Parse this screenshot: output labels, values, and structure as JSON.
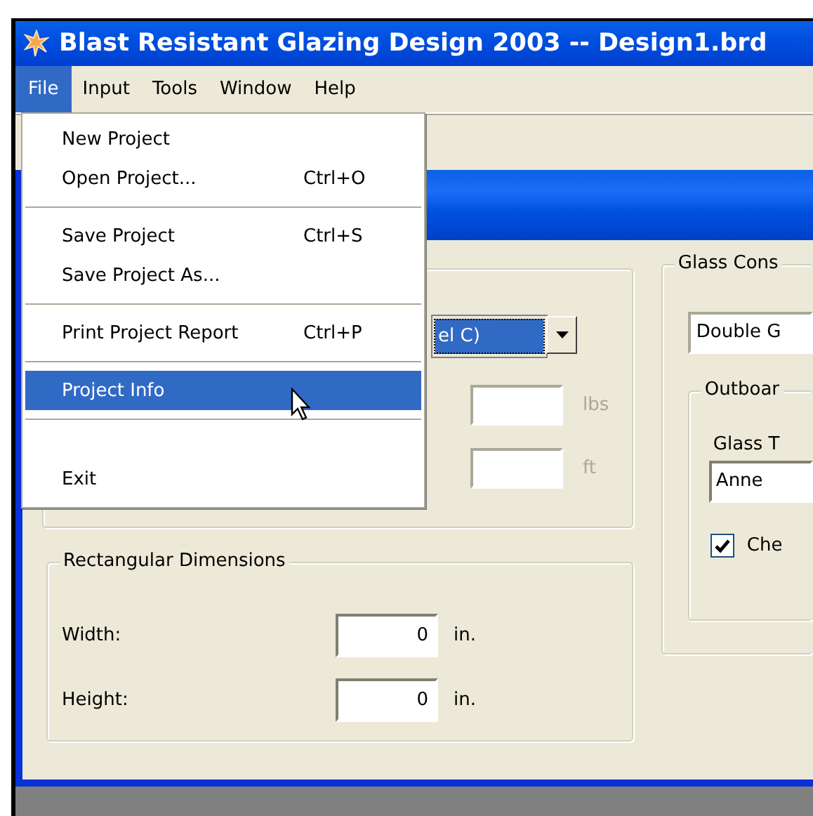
{
  "window": {
    "title": "Blast Resistant Glazing Design 2003 -- Design1.brd"
  },
  "menu_bar": [
    {
      "label": "File",
      "selected": true
    },
    {
      "label": "Input",
      "selected": false
    },
    {
      "label": "Tools",
      "selected": false
    },
    {
      "label": "Window",
      "selected": false
    },
    {
      "label": "Help",
      "selected": false
    }
  ],
  "file_menu": [
    {
      "kind": "item",
      "label": "New Project",
      "selected": false
    },
    {
      "kind": "item",
      "label": "Open Project...",
      "shortcut": "Ctrl+O",
      "selected": false
    },
    {
      "kind": "separator"
    },
    {
      "kind": "item",
      "label": "Save Project",
      "shortcut": "Ctrl+S",
      "selected": false
    },
    {
      "kind": "item",
      "label": "Save Project As...",
      "selected": false
    },
    {
      "kind": "separator"
    },
    {
      "kind": "item",
      "label": "Print Project Report",
      "shortcut": "Ctrl+P",
      "selected": false
    },
    {
      "kind": "separator"
    },
    {
      "kind": "item",
      "label": "Project Info",
      "selected": true
    },
    {
      "kind": "separator"
    },
    {
      "kind": "spacer"
    },
    {
      "kind": "item",
      "label": "Exit",
      "selected": false
    }
  ],
  "threat_group": {
    "combo_value": "el C)",
    "fields": [
      {
        "unit": "lbs",
        "disabled": true
      },
      {
        "unit": "ft",
        "disabled": true
      }
    ]
  },
  "rectangular_dimensions": {
    "title": "Rectangular Dimensions",
    "fields": [
      {
        "label": "Width:",
        "value": "0",
        "unit": "in."
      },
      {
        "label": "Height:",
        "value": "0",
        "unit": "in."
      }
    ]
  },
  "glass_construction": {
    "title": "Glass Cons",
    "type_value": "Double G",
    "outboard": {
      "title": "Outboar",
      "glass_type_label": "Glass T",
      "glass_type_value": "Anne",
      "checkbox": {
        "label": "Che",
        "checked": true
      }
    }
  }
}
